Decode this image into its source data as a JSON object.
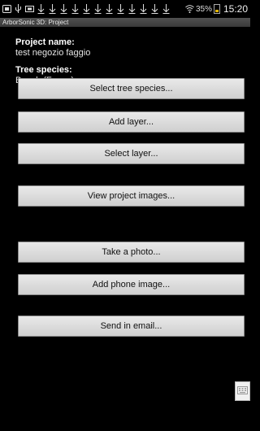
{
  "status_bar": {
    "signal_icon": "wifi-signal-icon",
    "battery_percent": "35%",
    "time": "15:20"
  },
  "app_bar": {
    "title": "ArborSonic 3D: Project"
  },
  "project": {
    "name_label": "Project name:",
    "name_value": "test negozio faggio",
    "species_label": "Tree species:",
    "species_value": "Beech (Fagus)"
  },
  "buttons": {
    "select_species": "Select tree species...",
    "add_layer": "Add layer...",
    "select_layer": "Select layer...",
    "view_images": "View project images...",
    "take_photo": "Take a photo...",
    "add_phone_image": "Add phone image...",
    "send_email": "Send in email..."
  },
  "colors": {
    "background": "#000000",
    "button_face": "#dcdcdc",
    "title_bar": "#454545"
  }
}
